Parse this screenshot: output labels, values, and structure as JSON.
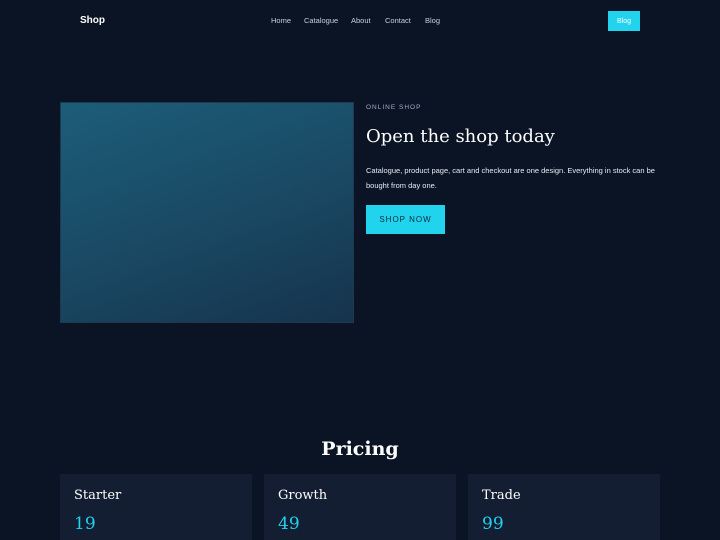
{
  "header": {
    "brand": "Shop",
    "nav": [
      "Home",
      "Catalogue",
      "About",
      "Contact",
      "Blog"
    ],
    "cta_label": "Blog"
  },
  "hero": {
    "eyebrow": "ONLINE SHOP",
    "title": "Open the shop today",
    "description": "Catalogue, product page, cart and checkout are one design. Everything in stock can be bought from day one.",
    "button_label": "SHOP NOW"
  },
  "pricing": {
    "title": "Pricing",
    "plans": [
      {
        "name": "Starter",
        "price": "19"
      },
      {
        "name": "Growth",
        "price": "49"
      },
      {
        "name": "Trade",
        "price": "99"
      }
    ]
  },
  "colors": {
    "background": "#0b1424",
    "accent": "#22d3ee",
    "card": "#131e33"
  }
}
